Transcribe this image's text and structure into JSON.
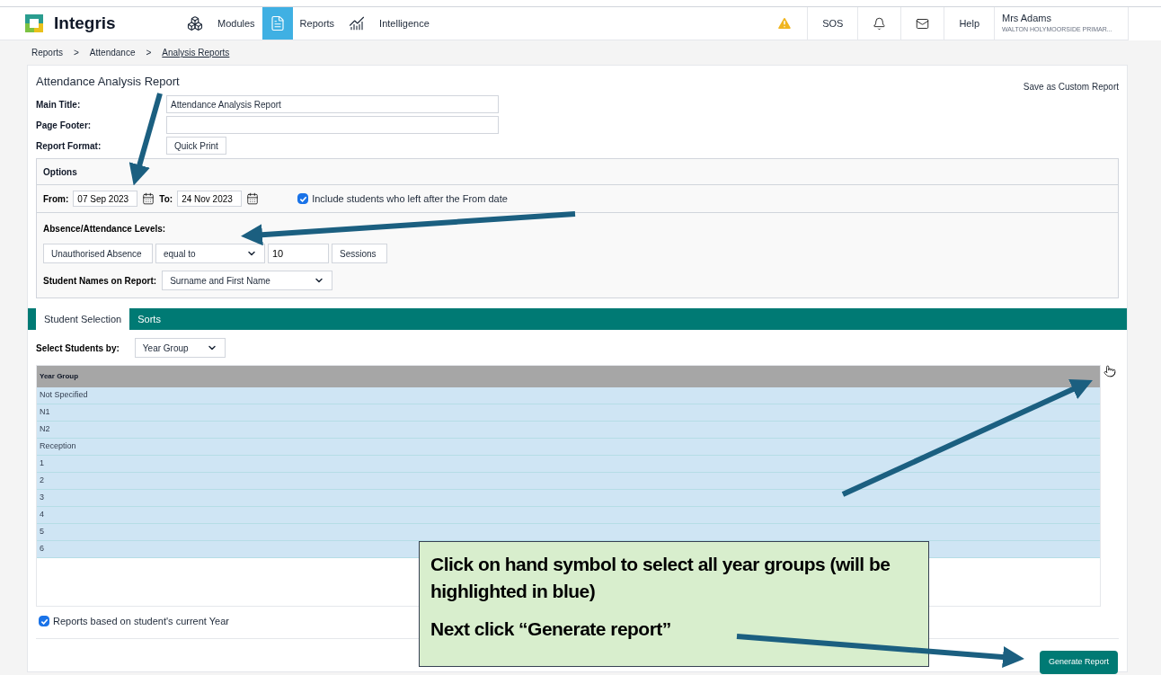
{
  "header": {
    "logo": "Integris",
    "nav": [
      {
        "label": "Modules",
        "kind": "cubes",
        "selected": false
      },
      {
        "label": "Reports",
        "kind": "document",
        "selected": true
      },
      {
        "label": "Intelligence",
        "kind": "chart",
        "selected": false
      }
    ],
    "actions": [
      {
        "kind": "warning"
      },
      {
        "kind": "text",
        "label": "SOS"
      },
      {
        "kind": "bell"
      },
      {
        "kind": "mail"
      },
      {
        "kind": "text",
        "label": "Help"
      }
    ],
    "user": {
      "name": "Mrs Adams",
      "school": "WALTON HOLYMOORSIDE PRIMAR..."
    }
  },
  "breadcrumb": [
    {
      "kind": "link",
      "label": "Reports",
      "current": false
    },
    {
      "kind": "separator",
      "label": ">"
    },
    {
      "kind": "link",
      "label": "Attendance",
      "current": false
    },
    {
      "kind": "separator",
      "label": ">"
    },
    {
      "kind": "link",
      "label": "Analysis Reports",
      "current": true
    }
  ],
  "report": {
    "title": "Attendance Analysis Report",
    "save_link": "Save as Custom Report",
    "fields": [
      {
        "label": "Main Title:",
        "kind": "text",
        "value": "Attendance Analysis Report"
      },
      {
        "label": "Page Footer:",
        "kind": "text"
      },
      {
        "label": "Report Format:",
        "kind": "select",
        "value": "Quick Print"
      }
    ]
  },
  "options": {
    "heading": "Options",
    "from_label": "From:",
    "from": "07 Sep 2023",
    "to_label": "To:",
    "to": "24 Nov 2023",
    "include_left": {
      "label": "Include students who left after the From date",
      "checked": true
    },
    "levels_label": "Absence/Attendance Levels:",
    "level_type": "Unauthorised Absence",
    "comparison": "equal to",
    "amount": "10",
    "unit": "Sessions",
    "names_label": "Student Names on Report:",
    "names": "Surname and First Name"
  },
  "tabs": [
    {
      "label": "Student Selection",
      "selected": true
    },
    {
      "label": "Sorts",
      "selected": false
    }
  ],
  "selection": {
    "label": "Select Students by:",
    "value": "Year Group",
    "column": "Year Group",
    "rows": [
      {
        "label": "Not Specified",
        "selected": true
      },
      {
        "label": "N1",
        "selected": true
      },
      {
        "label": "N2",
        "selected": true
      },
      {
        "label": "Reception",
        "selected": true
      },
      {
        "label": "1",
        "selected": true
      },
      {
        "label": "2",
        "selected": true
      },
      {
        "label": "3",
        "selected": true
      },
      {
        "label": "4",
        "selected": true
      },
      {
        "label": "5",
        "selected": true
      },
      {
        "label": "6",
        "selected": true
      }
    ],
    "current_year": {
      "label": "Reports based on student's current Year",
      "checked": true
    }
  },
  "generate": "Generate Report",
  "callout": [
    "Click on hand symbol to select all year groups (will be highlighted in blue)",
    "Next click “Generate report”"
  ]
}
